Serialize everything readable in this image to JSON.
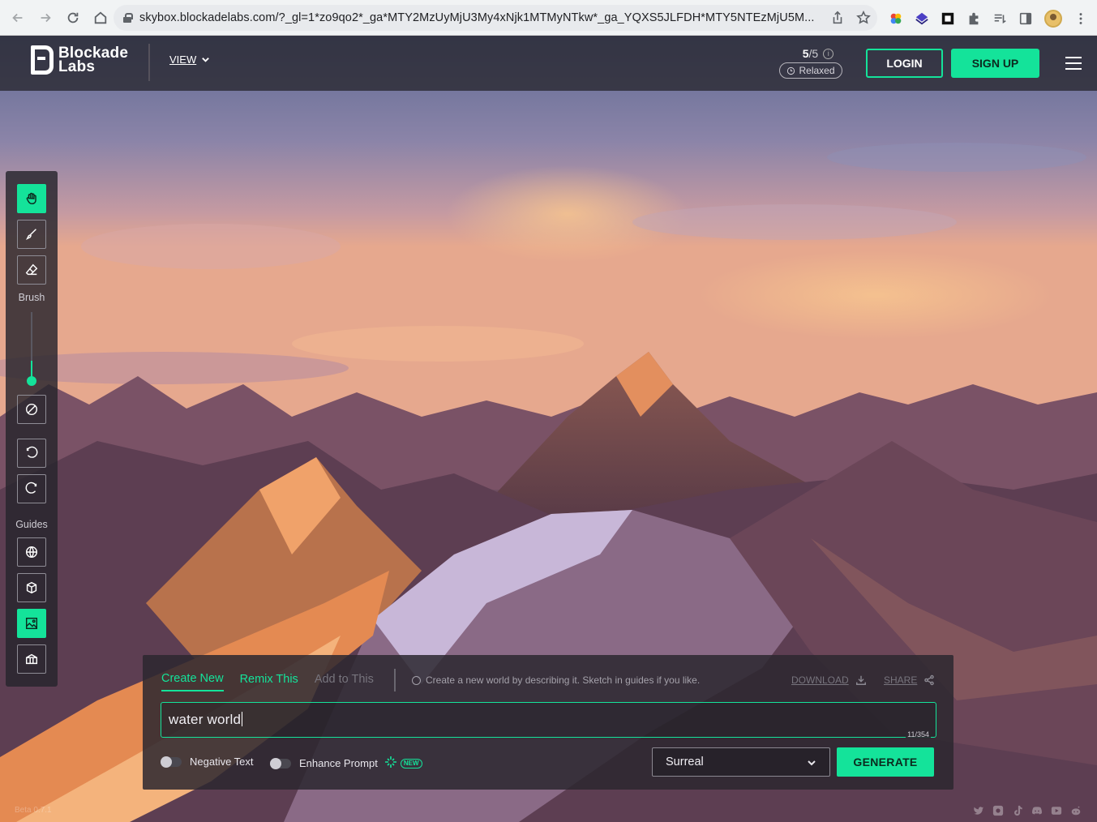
{
  "browser": {
    "url": "skybox.blockadelabs.com/?_gl=1*zo9qo2*_ga*MTY2MzUyMjU3My4xNjk1MTMyNTkw*_ga_YQXS5JLFDH*MTY5NTEzMjU5M..."
  },
  "header": {
    "logo_line1": "Blockade",
    "logo_line2": "Labs",
    "view_label": "VIEW",
    "credits_used": "5",
    "credits_total": "/5",
    "mode_label": "Relaxed",
    "login_label": "LOGIN",
    "signup_label": "SIGN UP"
  },
  "toolbar": {
    "brush_label": "Brush",
    "guides_label": "Guides",
    "brush_size_fraction": 0.3
  },
  "panel": {
    "tabs": [
      {
        "label": "Create New"
      },
      {
        "label": "Remix This"
      },
      {
        "label": "Add to This"
      }
    ],
    "hint": "Create a new world by describing it. Sketch in guides if you like.",
    "download_label": "DOWNLOAD",
    "share_label": "SHARE",
    "prompt_value": "water world",
    "char_count": "11/354",
    "negative_text_label": "Negative Text",
    "enhance_prompt_label": "Enhance Prompt",
    "new_badge": "NEW",
    "style_value": "Surreal",
    "generate_label": "GENERATE"
  },
  "footer": {
    "version": "Beta 0.7.1",
    "socials": [
      "twitter-icon",
      "instagram-icon",
      "tiktok-icon",
      "discord-icon",
      "youtube-icon",
      "reddit-icon"
    ]
  },
  "colors": {
    "accent": "#14e39a",
    "panel_bg": "#2c2830"
  }
}
